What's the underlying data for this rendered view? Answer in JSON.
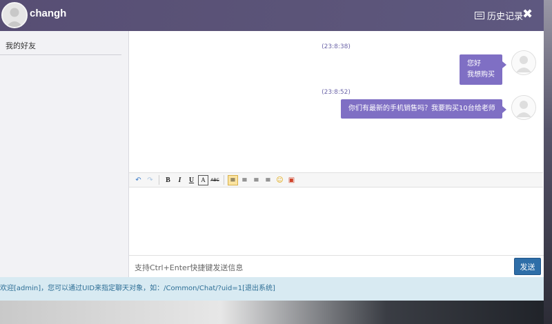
{
  "titlebar": {
    "username": "changh",
    "history_label": "历史记录",
    "history_icon": "list-icon",
    "close_icon": "close-icon",
    "close_glyph": "✖"
  },
  "sidebar": {
    "header": "我的好友"
  },
  "messages": [
    {
      "time": "(23:8:38)",
      "lines": [
        "您好",
        "我想购买"
      ]
    },
    {
      "time": "(23:8:52)",
      "lines": [
        "你们有最新的手机销售吗？我要购买10台给老师"
      ]
    }
  ],
  "toolbar": {
    "buttons": [
      {
        "name": "undo-icon",
        "glyph": "↶"
      },
      {
        "name": "redo-icon",
        "glyph": "↷"
      },
      {
        "name": "bold-button",
        "glyph": "B"
      },
      {
        "name": "italic-button",
        "glyph": "I"
      },
      {
        "name": "underline-button",
        "glyph": "U"
      },
      {
        "name": "font-color-button",
        "glyph": "A"
      },
      {
        "name": "strikethrough-button",
        "glyph": "ABC"
      },
      {
        "name": "align-left-button",
        "glyph": "≡"
      },
      {
        "name": "align-center-button",
        "glyph": "≡"
      },
      {
        "name": "align-right-button",
        "glyph": "≡"
      },
      {
        "name": "align-justify-button",
        "glyph": "≡"
      },
      {
        "name": "emoji-icon",
        "glyph": "☺"
      },
      {
        "name": "image-icon",
        "glyph": "▣"
      }
    ]
  },
  "input": {
    "placeholder": "支持Ctrl+Enter快捷键发送信息",
    "send_label": "发送"
  },
  "status": {
    "text": "欢迎[admin]，您可以通过UID来指定聊天对象，如：/Common/Chat/?uid=1",
    "logout_label": "[退出系统]"
  },
  "colors": {
    "titlebar": "#5b5478",
    "bubble": "#7f6fc4",
    "send_button": "#2e6ea8",
    "statusbar": "#d8eaf2"
  }
}
